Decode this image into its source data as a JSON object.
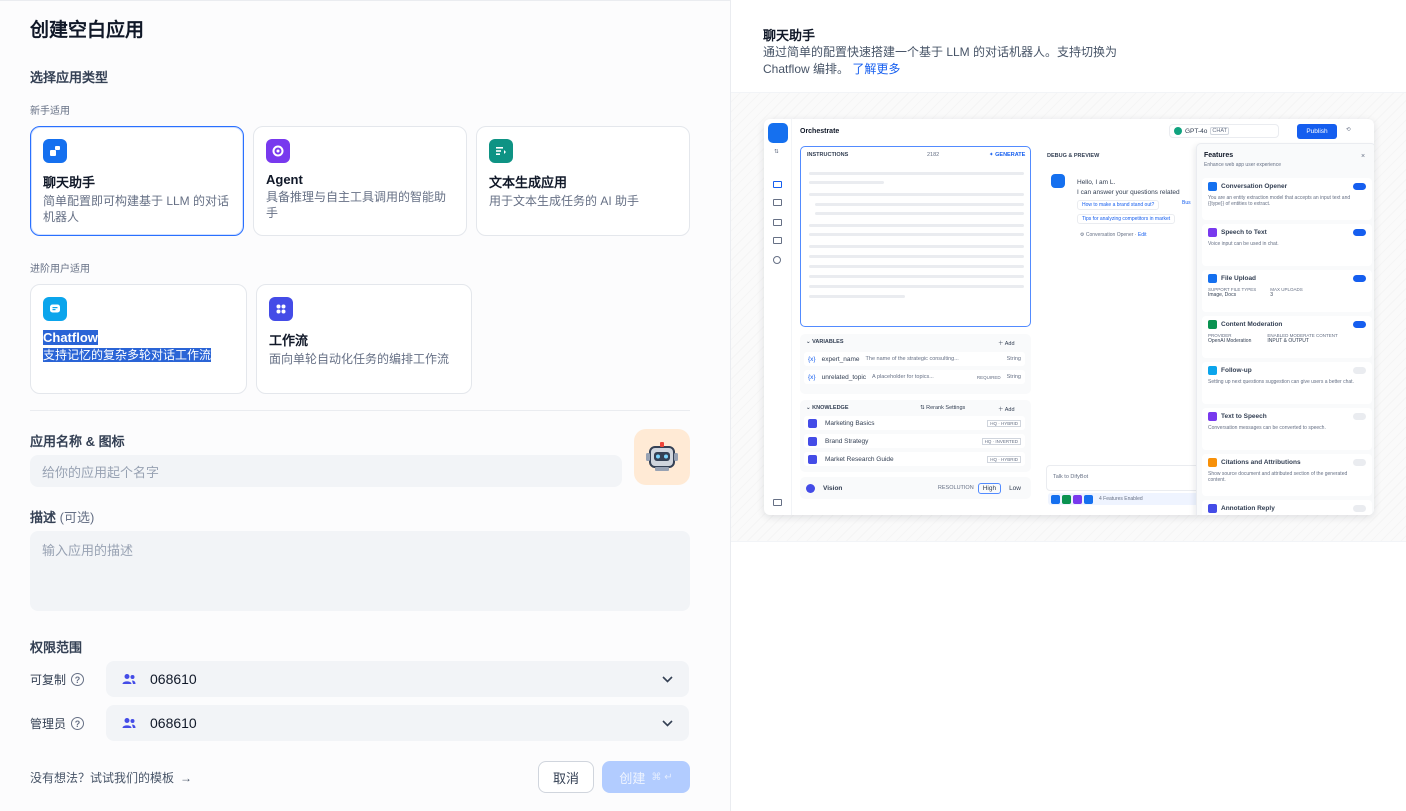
{
  "left": {
    "title": "创建空白应用",
    "app_type_label": "选择应用类型",
    "beginner_label": "新手适用",
    "advanced_label": "进阶用户适用",
    "cards": [
      {
        "title": "聊天助手",
        "desc": "简单配置即可构建基于 LLM 的对话机器人",
        "color": "#1570ef"
      },
      {
        "title": "Agent",
        "desc": "具备推理与自主工具调用的智能助手",
        "color": "#7839ee"
      },
      {
        "title": "文本生成应用",
        "desc": "用于文本生成任务的 AI 助手",
        "color": "#0e9384"
      },
      {
        "title": "Chatflow",
        "desc": "支持记忆的复杂多轮对话工作流",
        "color": "#0ba5ec"
      },
      {
        "title": "工作流",
        "desc": "面向单轮自动化任务的编排工作流",
        "color": "#444ce7"
      }
    ],
    "name_label": "应用名称 & 图标",
    "name_placeholder": "给你的应用起个名字",
    "desc_label": "描述",
    "desc_optional": "(可选)",
    "desc_placeholder": "输入应用的描述",
    "perm_label": "权限范围",
    "copy_label": "可复制",
    "admin_label": "管理员",
    "copy_value": "068610",
    "admin_value": "068610",
    "template_link": "没有想法？试试我们的模板",
    "cancel": "取消",
    "create": "创建"
  },
  "right": {
    "title": "聊天助手",
    "desc": "通过简单的配置快速搭建一个基于 LLM 的对话机器人。支持切换为 Chatflow 编排。",
    "learn_more": "了解更多",
    "preview": {
      "orchestrate": "Orchestrate",
      "model": "GPT-4o",
      "model_tag": "CHAT",
      "publish": "Publish",
      "instructions": "INSTRUCTIONS",
      "count": "2182",
      "generate": "GENERATE",
      "debug": "DEBUG & PREVIEW",
      "hello": "Hello, I am L.",
      "hello2": "I can answer your questions related",
      "q1": "How to make a brand stand out?",
      "q1b": "Bus",
      "q2": "Tips for analyzing competitors in market",
      "opener": "Conversation Opener",
      "edit": "Edit",
      "variables": "VARIABLES",
      "add": "Add",
      "vars": [
        {
          "name": "expert_name",
          "desc": "The name of the strategic consulting...",
          "type": "String"
        },
        {
          "name": "unrelated_topic",
          "desc": "A placeholder for topics...",
          "req": "REQUIRED",
          "type": "String"
        }
      ],
      "knowledge": "KNOWLEDGE",
      "rerank": "Rerank Settings",
      "kb": [
        {
          "name": "Marketing Basics",
          "tag": "HQ · HYBRID"
        },
        {
          "name": "Brand Strategy",
          "tag": "HQ · INVERTED"
        },
        {
          "name": "Market Research Guide",
          "tag": "HQ · HYBRID"
        }
      ],
      "vision": "Vision",
      "resolution": "RESOLUTION",
      "high": "High",
      "low": "Low",
      "talk": "Talk to DifyBot",
      "features_enabled": "4 Features Enabled",
      "features": "Features",
      "features_sub": "Enhance web app user experience",
      "feature_list": [
        {
          "name": "Conversation Opener",
          "desc": "You are an entity extraction model that accepts an input text and {{type}} of entities to extract.",
          "on": true,
          "color": "#1570ef"
        },
        {
          "name": "Speech to Text",
          "desc": "Voice input can be used in chat.",
          "on": true,
          "color": "#7839ee"
        },
        {
          "name": "File Upload",
          "desc": "",
          "on": true,
          "color": "#1570ef",
          "k1": "SUPPORT FILE TYPES",
          "v1": "Image, Docs",
          "k2": "MAX UPLOADS",
          "v2": "3"
        },
        {
          "name": "Content Moderation",
          "desc": "",
          "on": true,
          "color": "#099250",
          "k1": "PROVIDER",
          "v1": "OpenAI Moderation",
          "k2": "ENABLED MODERATE CONTENT",
          "v2": "INPUT & OUTPUT"
        },
        {
          "name": "Follow-up",
          "desc": "Setting up next questions suggestion can give users a better chat.",
          "on": false,
          "color": "#0ba5ec"
        },
        {
          "name": "Text to Speech",
          "desc": "Conversation messages can be converted to speech.",
          "on": false,
          "color": "#7839ee"
        },
        {
          "name": "Citations and Attributions",
          "desc": "Show source document and attributed section of the generated content.",
          "on": false,
          "color": "#f79009"
        },
        {
          "name": "Annotation Reply",
          "desc": "",
          "on": false,
          "color": "#444ce7"
        }
      ]
    }
  }
}
